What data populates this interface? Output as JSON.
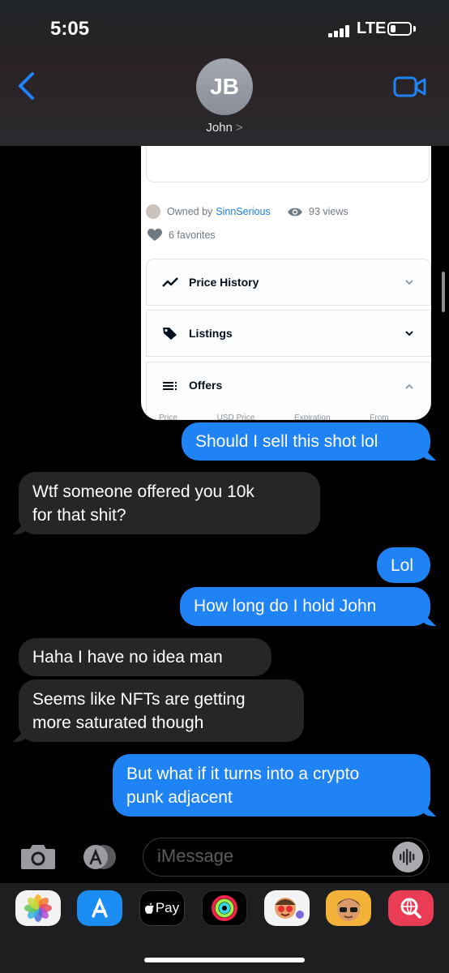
{
  "status_bar": {
    "time": "5:05",
    "network": "LTE"
  },
  "header": {
    "initials": "JB",
    "contact_name": "John",
    "chevron": ">"
  },
  "shared_image": {
    "owner_prefix": "Owned by",
    "owner_name": "SinnSerious",
    "views": "93 views",
    "favorites": "6 favorites",
    "panels": [
      {
        "label": "Price History"
      },
      {
        "label": "Listings"
      },
      {
        "label": "Offers"
      }
    ],
    "offer_columns": [
      "Price",
      "USD Price",
      "Expiration",
      "From"
    ]
  },
  "messages": [
    {
      "direction": "outgoing",
      "text": "Should I sell this shot lol"
    },
    {
      "direction": "incoming",
      "lines": [
        "Wtf someone offered you 10k",
        "for that shit?"
      ]
    },
    {
      "direction": "outgoing",
      "text": "Lol"
    },
    {
      "direction": "outgoing",
      "text": "How long do I hold John"
    },
    {
      "direction": "incoming",
      "text": "Haha I have no idea man"
    },
    {
      "direction": "incoming",
      "lines": [
        "Seems like NFTs are getting",
        "more saturated though"
      ]
    },
    {
      "direction": "outgoing",
      "lines": [
        "But what if it turns into a crypto",
        "punk adjacent"
      ]
    }
  ],
  "input": {
    "placeholder": "iMessage"
  },
  "app_drawer": {
    "apps": [
      {
        "icon": "photos-icon"
      },
      {
        "icon": "app-store-icon"
      },
      {
        "icon": "apple-pay-icon",
        "label": "Pay"
      },
      {
        "icon": "activity-icon"
      },
      {
        "icon": "memoji-stickers-icon"
      },
      {
        "icon": "animoji-icon"
      },
      {
        "icon": "web-search-icon"
      }
    ]
  },
  "colors": {
    "outgoing_bubble": "#1f83f5",
    "incoming_bubble": "#262629",
    "accent": "#1f83f5",
    "background": "#000000"
  }
}
